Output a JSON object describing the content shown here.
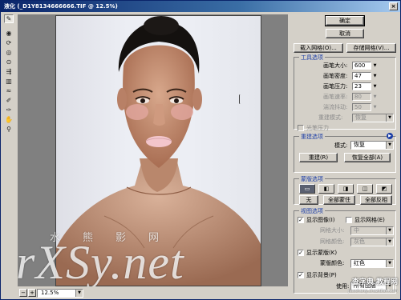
{
  "window": {
    "title": "液化 (_D1Y8134666666.TIF @ 12.5%)",
    "close": "×"
  },
  "tools": [
    {
      "name": "forward-warp-tool",
      "glyph": "✎"
    },
    {
      "name": "reconstruct-tool",
      "glyph": "◉"
    },
    {
      "name": "twirl-clockwise-tool",
      "glyph": "⟳"
    },
    {
      "name": "pucker-tool",
      "glyph": "◎"
    },
    {
      "name": "bloat-tool",
      "glyph": "⊙"
    },
    {
      "name": "push-left-tool",
      "glyph": "⇶"
    },
    {
      "name": "mirror-tool",
      "glyph": "▥"
    },
    {
      "name": "turbulence-tool",
      "glyph": "≈"
    },
    {
      "name": "freeze-mask-tool",
      "glyph": "✐"
    },
    {
      "name": "thaw-mask-tool",
      "glyph": "✑"
    },
    {
      "name": "hand-tool",
      "glyph": "✋"
    },
    {
      "name": "zoom-tool",
      "glyph": "⚲"
    }
  ],
  "watermark": {
    "chars": [
      "水",
      "熊",
      "影",
      "网"
    ],
    "brand": "rXSy.net",
    "site_cn": "查字典 教程网",
    "site_url": "jiaocheng.chazidian.com"
  },
  "status": {
    "minus": "−",
    "plus": "+",
    "zoom": "12.5%"
  },
  "panel": {
    "ok": "确定",
    "cancel": "取消",
    "load_mesh": "载入网格(O)...",
    "save_mesh": "存储网格(V)...",
    "tool_options": {
      "title": "工具选项",
      "brush_size_label": "画笔大小:",
      "brush_size": "600",
      "brush_density_label": "画笔密度:",
      "brush_density": "47",
      "brush_pressure_label": "画笔压力:",
      "brush_pressure": "23",
      "brush_rate_label": "画笔速率:",
      "brush_rate": "80",
      "turbulent_jitter_label": "湍流抖动:",
      "turbulent_jitter": "50",
      "reconstruct_mode_label": "重建模式:",
      "reconstruct_mode": "恢复",
      "stylus_label": "光笔压力"
    },
    "reconstruct_options": {
      "title": "重建选项",
      "mode_label": "模式:",
      "mode": "恢复",
      "reconstruct": "重建(R)",
      "restore_all": "恢复全部(A)"
    },
    "mask_options": {
      "title": "蒙版选项",
      "none": "无",
      "mask_all": "全部蒙住",
      "invert_all": "全部反相"
    },
    "view_options": {
      "title": "视图选项",
      "show_image": "显示图像(I)",
      "show_mesh": "显示网格(E)",
      "mesh_size_label": "网格大小:",
      "mesh_size": "中",
      "mesh_color_label": "网格颜色:",
      "mesh_color": "灰色",
      "show_mask": "显示蒙版(K)",
      "mask_color_label": "蒙版颜色:",
      "mask_color": "红色",
      "show_backdrop": "显示背景(P)",
      "use_label": "使用:",
      "use": "所有图层"
    }
  },
  "colors": {
    "accent": "#1c3ea6",
    "title_start": "#0a246a",
    "title_end": "#a6caf0"
  }
}
